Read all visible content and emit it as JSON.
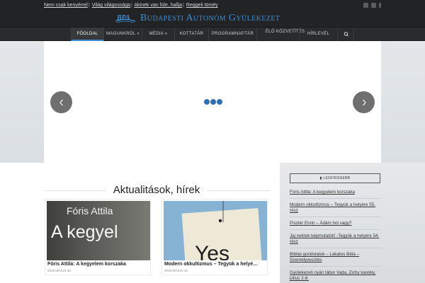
{
  "topbar": {
    "links": [
      "Nem csak kenyérrel",
      "Világ világossága",
      "Akinek van füle, hallja",
      "Reggeli töméy"
    ],
    "social_icons": [
      "facebook-icon",
      "youtube-icon",
      "more-icon"
    ]
  },
  "logo": {
    "mark_text": "BPA",
    "title": "Budapesti Autonóm Gyülekezet"
  },
  "nav": {
    "items": [
      {
        "label": "Főoldal",
        "active": true
      },
      {
        "label": "Magunkról »"
      },
      {
        "label": "Média »"
      },
      {
        "label": "Kottatár"
      },
      {
        "label": "Programnaptár"
      },
      {
        "label": "Élő közvetítés"
      },
      {
        "label": "Hírlevél"
      }
    ],
    "search_icon": "search-icon"
  },
  "slider": {
    "prev_icon": "chevron-left-icon",
    "next_icon": "chevron-right-icon",
    "loader_icon": "loading-dots-icon"
  },
  "news": {
    "section_title": "Aktualitások, hírek",
    "cards": [
      {
        "image_text_1": "Fóris Attila",
        "image_text_2": "A kegyel",
        "caption": "Fóris Attila: A kegyelem korszaka",
        "date": "2018 május 25."
      },
      {
        "image_text": "Yes",
        "caption": "Modern okkultizmus – Tegyük a helyé…",
        "date": "2018 május 19."
      }
    ]
  },
  "sidebar": {
    "widget_title": "Legfrissebb",
    "widget_icon": "document-icon",
    "posts": [
      "Fóris Attila: A kegyelem korszaka",
      "Modern okkultizmus – Tegyük a helyére 55. rész",
      "Pisztér Ervin – Ádám hol vagy?",
      "Jaj nektek képmutatók! -Tegyük a helyére 54. rész",
      "Bibliai gondolatok – Lakatos Béla – Személyvesztés",
      "Gyülekezeti nyári tábor Vajta, Zichy kastély, július 2-8."
    ]
  },
  "colors": {
    "brand_blue": "#3f8ed3",
    "topbar_bg": "#222324",
    "loader_blue": "#2f6fb4"
  }
}
